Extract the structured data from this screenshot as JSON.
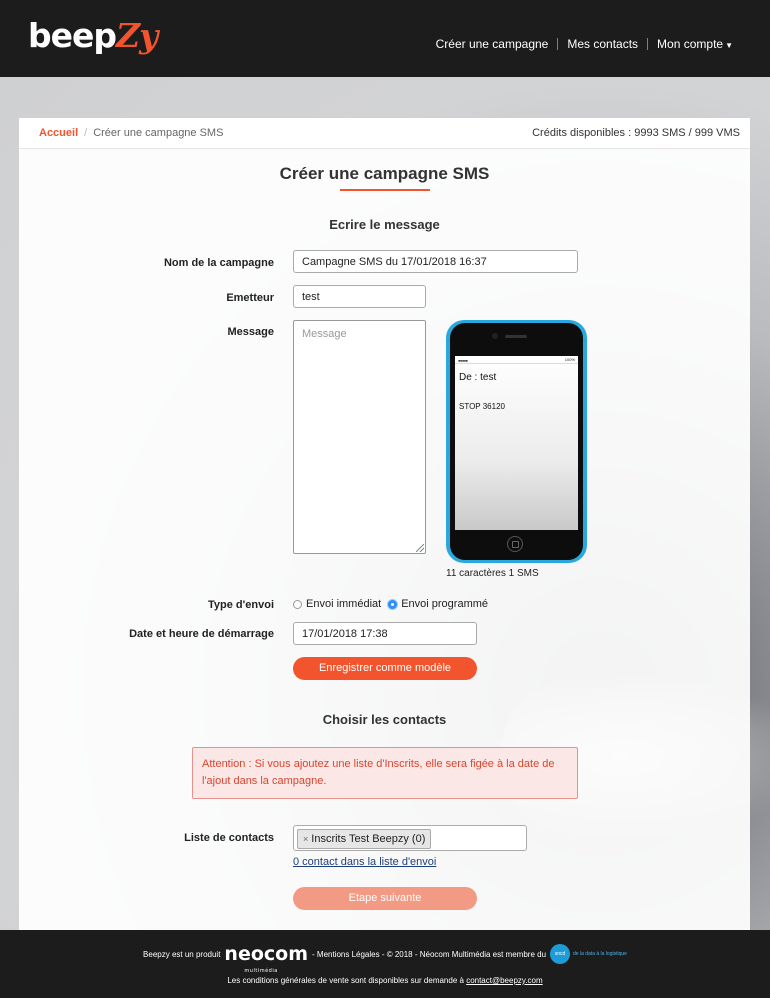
{
  "header": {
    "logo_main": "beep",
    "logo_accent": "Zy",
    "nav": [
      "Créer une campagne",
      "Mes contacts",
      "Mon compte"
    ]
  },
  "breadcrumb": {
    "home": "Accueil",
    "current": "Créer une campagne SMS"
  },
  "credits": "Crédits disponibles : 9993 SMS / 999 VMS",
  "page_title": "Créer une campagne SMS",
  "section_message": "Ecrire le message",
  "form": {
    "name_label": "Nom de la campagne",
    "name_value": "Campagne SMS du 17/01/2018 16:37",
    "sender_label": "Emetteur",
    "sender_value": "test",
    "message_label": "Message",
    "message_placeholder": "Message",
    "send_type_label": "Type d'envoi",
    "send_type_options": [
      "Envoi immédiat",
      "Envoi programmé"
    ],
    "send_type_selected": "Envoi programmé",
    "datetime_label": "Date et heure de démarrage",
    "datetime_value": "17/01/2018 17:38",
    "save_template_button": "Enregistrer comme modèle"
  },
  "preview": {
    "battery": "100%",
    "from": "De : test",
    "stop": "STOP 36120",
    "counter": "11 caractères 1 SMS"
  },
  "section_contacts": "Choisir les contacts",
  "alert": "Attention : Si vous ajoutez une liste d'Inscrits, elle sera figée à la date de l'ajout dans la campagne.",
  "contacts": {
    "label": "Liste de contacts",
    "tag": "Inscrits Test Beepzy (0)",
    "tag_remove": "×",
    "count_link": "0 contact dans la liste d'envoi"
  },
  "next_button": "Etape suivante",
  "footer": {
    "prefix": "Beepzy est un produit",
    "neocom": "neocom",
    "neocom_sub": "multimédia",
    "middle": "- Mentions Légales - © 2018 - Néocom Multimédia est membre du",
    "sncd": "sncd",
    "sncd_text": "de la data à la logistique",
    "conditions": "Les conditions générales de vente sont disponibles sur demande à",
    "email": "contact@beepzy.com",
    "colors": {
      "accent": "#f2542d",
      "dark": "#1c1c1d",
      "link": "#1f3f7a"
    }
  }
}
